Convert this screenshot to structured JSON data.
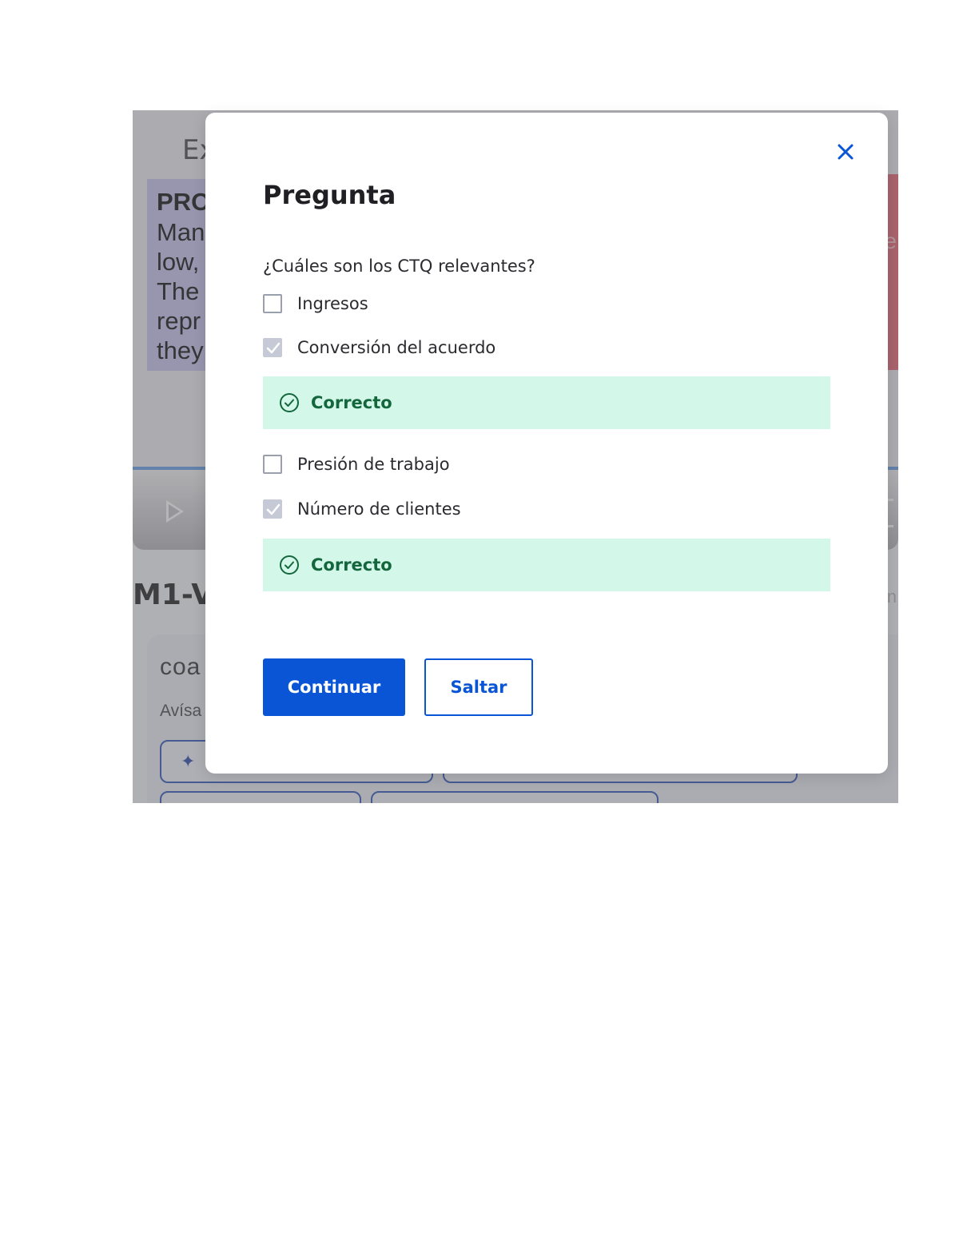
{
  "background": {
    "video_title_partial": "Ex",
    "slide_lines": [
      "PRO",
      "Man",
      "low,",
      "The",
      "repr",
      "they"
    ],
    "red_panel_letter": "e",
    "heading_partial": "M1-V",
    "right_mark": "n",
    "card_brand_partial": "coa",
    "card_text_partial": "Avísa"
  },
  "modal": {
    "title": "Pregunta",
    "question": "¿Cuáles son los CTQ relevantes?",
    "options": [
      {
        "label": "Ingresos",
        "checked": false
      },
      {
        "label": "Conversión del acuerdo",
        "checked": true,
        "feedback": "Correcto"
      },
      {
        "label": "Presión de trabajo",
        "checked": false
      },
      {
        "label": "Número de clientes",
        "checked": true,
        "feedback": "Correcto"
      }
    ],
    "continue_label": "Continuar",
    "skip_label": "Saltar"
  },
  "colors": {
    "primary": "#0a55d6",
    "success_bg": "#d3f8ea",
    "success_text": "#14663c"
  }
}
